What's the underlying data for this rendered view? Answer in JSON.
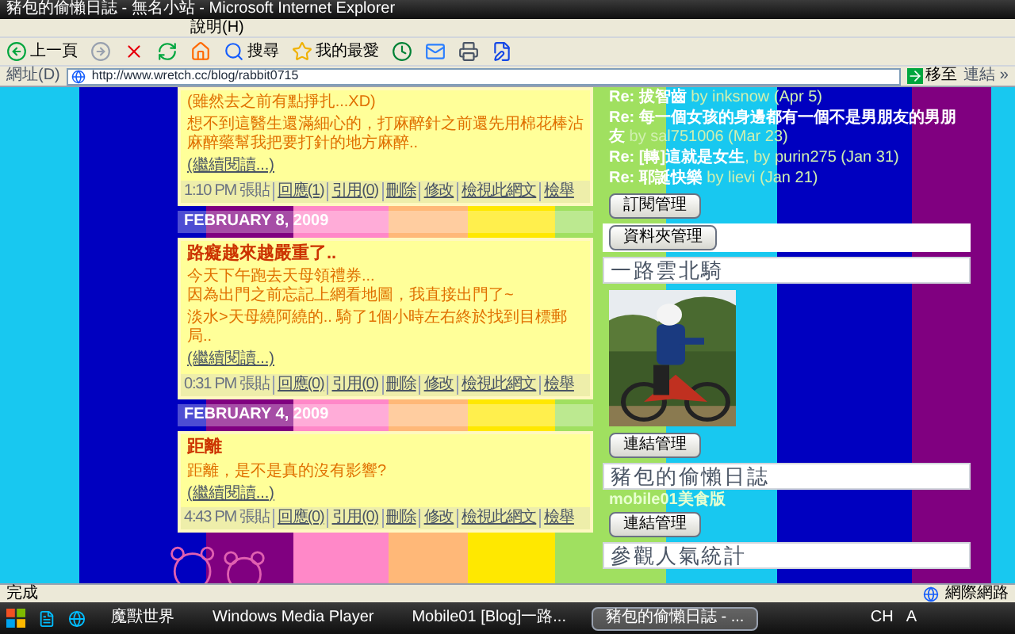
{
  "window": {
    "title": "豬包的偷懶日誌 - 無名小站 - Microsoft Internet Explorer"
  },
  "menu": [
    {
      "label": "說明(H)"
    }
  ],
  "toolbar": [
    {
      "kind": "back",
      "label": "上一頁"
    },
    {
      "kind": "forward"
    },
    {
      "kind": "stop"
    },
    {
      "kind": "refresh"
    },
    {
      "kind": "home"
    },
    {
      "kind": "search",
      "label": "搜尋"
    },
    {
      "kind": "favorites",
      "label": "我的最愛"
    },
    {
      "kind": "history"
    },
    {
      "kind": "mail"
    },
    {
      "kind": "print"
    },
    {
      "kind": "edit"
    }
  ],
  "address": {
    "label": "網址(D)",
    "url": "http://www.wretch.cc/blog/rabbit0715",
    "go": "移至",
    "links": "連結 »"
  },
  "blog": [
    {
      "kind": "post",
      "lines": [
        "(雖然去之前有點掙扎...XD)",
        "想不到這醫生還滿細心的，打麻醉針之前還先用棉花棒沾麻醉藥幫我把要打針的地方麻醉.."
      ],
      "more": "(繼續閱讀...)",
      "time": "1:10 PM 張貼",
      "links": [
        "回應(1)",
        "引用(0)",
        "刪除",
        "修改",
        "檢視此網文",
        "檢舉"
      ]
    },
    {
      "kind": "date",
      "text": "FEBRUARY 8, 2009"
    },
    {
      "kind": "post",
      "title": "路癡越來越嚴重了..",
      "lines": [
        "今天下午跑去天母領禮券...\n因為出門之前忘記上網看地圖，我直接出門了~",
        "淡水>天母繞阿繞的.. 騎了1個小時左右終於找到目標郵局.."
      ],
      "more": "(繼續閱讀...)",
      "time": "0:31 PM 張貼",
      "links": [
        "回應(0)",
        "引用(0)",
        "刪除",
        "修改",
        "檢視此網文",
        "檢舉"
      ]
    },
    {
      "kind": "date",
      "text": "FEBRUARY 4, 2009"
    },
    {
      "kind": "post",
      "title": "距離",
      "lines": [
        "距離，是不是真的沒有影響?"
      ],
      "more": "(繼續閱讀...)",
      "time": "4:43 PM 張貼",
      "links": [
        "回應(0)",
        "引用(0)",
        "刪除",
        "修改",
        "檢視此網文",
        "檢舉"
      ]
    }
  ],
  "sidebar": {
    "comments": [
      {
        "re": "Re: 拔智齒",
        "by": " by inksnow (Apr 5)"
      },
      {
        "re": "Re: 每一個女孩的身邊都有一個不是男朋友的男朋友",
        "by": " by sal751006 (Mar 23)"
      },
      {
        "re": "Re: [轉]這就是女生",
        "by": ", by purin275 (Jan 31)"
      },
      {
        "re": "Re: 耶誕快樂",
        "by": " by lievi (Jan 21)"
      }
    ],
    "subscribe": "訂閱管理",
    "modules": [
      {
        "kind": "folder",
        "button": "資料夾管理"
      },
      {
        "title": "一路雲北騎",
        "button": "連結管理"
      },
      {
        "kind": "links",
        "title": "豬包的偷懶日誌",
        "link": "mobile01美食版",
        "button": "連結管理"
      },
      {
        "kind": "stats",
        "title": "參觀人氣統計"
      }
    ]
  },
  "status": {
    "text": "完成",
    "zone": "網際網路"
  },
  "taskbar": {
    "tasks": [
      {
        "label": "魔獸世界",
        "selected": false
      },
      {
        "label": "Windows Media Player",
        "selected": false
      },
      {
        "label": "Mobile01 [Blog]一路...",
        "selected": false
      },
      {
        "label": "豬包的偷懶日誌 - ...",
        "selected": true
      }
    ],
    "tray": [
      "CH",
      "A"
    ]
  }
}
